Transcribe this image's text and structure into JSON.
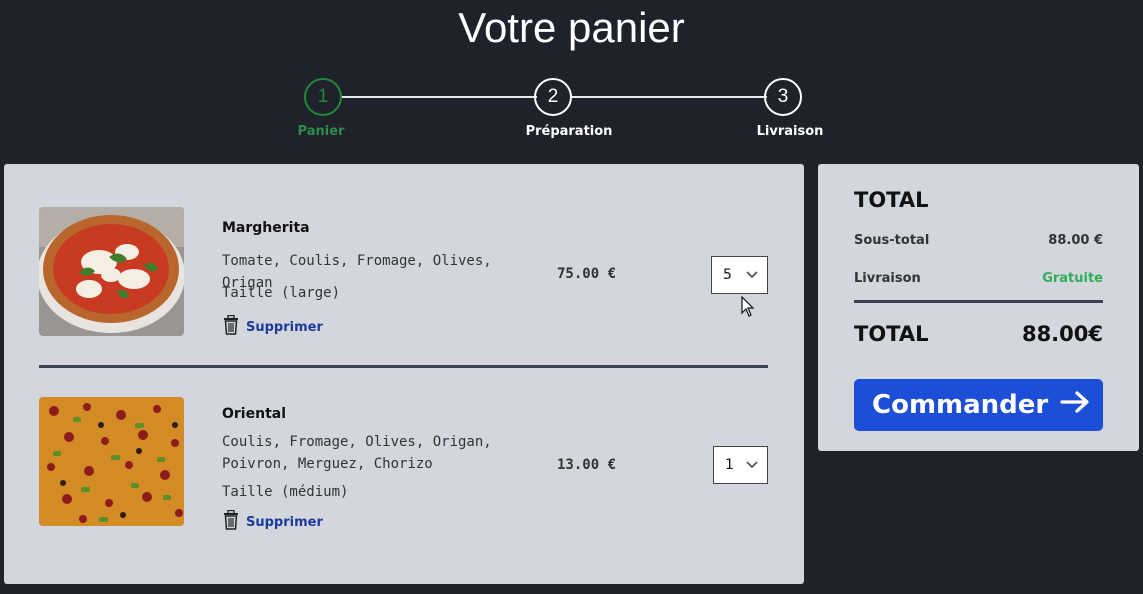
{
  "page": {
    "title": "Votre panier"
  },
  "stepper": {
    "steps": [
      {
        "number": "1",
        "label": "Panier",
        "active": true
      },
      {
        "number": "2",
        "label": "Préparation",
        "active": false
      },
      {
        "number": "3",
        "label": "Livraison",
        "active": false
      }
    ]
  },
  "cart": {
    "items": [
      {
        "name": "Margherita",
        "ingredients": "Tomate, Coulis, Fromage, Olives, Origan",
        "size": "Taille (large)",
        "delete_label": "Supprimer",
        "price": "75.00 €",
        "quantity": "5",
        "image": "pizza-margherita"
      },
      {
        "name": "Oriental",
        "ingredients": "Coulis, Fromage, Olives, Origan, Poivron, Merguez, Chorizo",
        "size": "Taille (médium)",
        "delete_label": "Supprimer",
        "price": "13.00 €",
        "quantity": "1",
        "image": "pizza-oriental"
      }
    ]
  },
  "summary": {
    "title": "TOTAL",
    "subtotal_label": "Sous-total",
    "subtotal_value": "88.00 €",
    "delivery_label": "Livraison",
    "delivery_value": "Gratuite",
    "total_label": "TOTAL",
    "total_value": "88.00€",
    "order_button": "Commander"
  },
  "colors": {
    "background": "#1f222a",
    "panel": "#d4d6dd",
    "accent_green": "#1f8a3a",
    "free_green": "#2fae57",
    "button_blue": "#1d4ed8",
    "link_blue": "#1d3b9a"
  }
}
